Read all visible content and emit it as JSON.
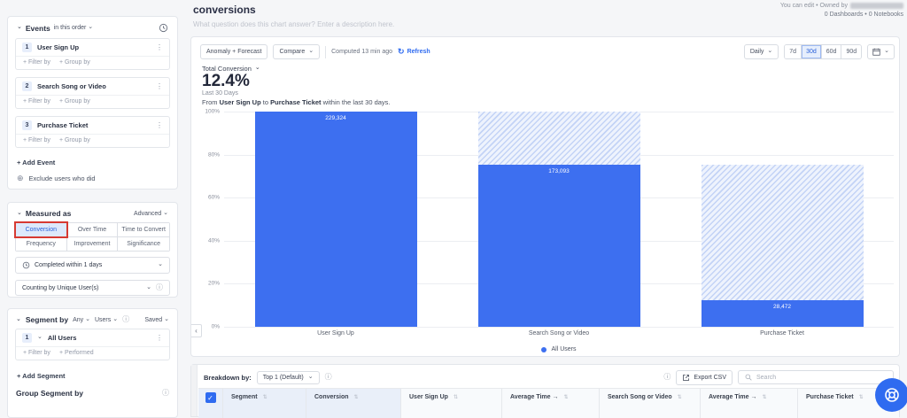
{
  "page": {
    "title": "conversions",
    "description_placeholder": "What question does this chart answer? Enter a description here.",
    "permission_text": "You can edit • Owned by",
    "counts_text": "0 Dashboards • 0 Notebooks"
  },
  "sidebar": {
    "events": {
      "title": "Events",
      "order_label": "in this order",
      "items": [
        {
          "index": "1",
          "name": "User Sign Up"
        },
        {
          "index": "2",
          "name": "Search Song or Video"
        },
        {
          "index": "3",
          "name": "Purchase Ticket"
        }
      ],
      "filter_by": "+ Filter by",
      "group_by": "+ Group by",
      "add_event": "+ Add Event",
      "exclude": "Exclude users who did"
    },
    "measured_as": {
      "title": "Measured as",
      "advanced": "Advanced",
      "options": [
        "Conversion",
        "Over Time",
        "Time to Convert",
        "Frequency",
        "Improvement",
        "Significance"
      ],
      "selected": "Conversion",
      "completed_within": "Completed within 1 days",
      "counting_by": "Counting by Unique User(s)"
    },
    "segment_by": {
      "title": "Segment by",
      "any_label": "Any",
      "users_label": "Users",
      "saved_label": "Saved",
      "item": {
        "index": "1",
        "name": "All Users"
      },
      "filter_by": "+ Filter by",
      "performed": "+ Performed",
      "add_segment": "+ Add Segment",
      "group_segment_by": "Group Segment by"
    }
  },
  "toolbar": {
    "anomaly_forecast": "Anomaly + Forecast",
    "compare": "Compare",
    "computed": "Computed 13 min ago",
    "refresh": "Refresh",
    "granularity": "Daily",
    "ranges": [
      "7d",
      "30d",
      "60d",
      "90d"
    ],
    "selected_range": "30d"
  },
  "kpi": {
    "metric_label": "Total Conversion",
    "value": "12.4%",
    "period": "Last 30 Days",
    "desc_prefix": "From",
    "from_event": "User Sign Up",
    "desc_mid": "to",
    "to_event": "Purchase Ticket",
    "desc_suffix": "within the last 30 days."
  },
  "chart_data": {
    "type": "bar",
    "title": "Total Conversion funnel",
    "categories": [
      "User Sign Up",
      "Search Song or Video",
      "Purchase Ticket"
    ],
    "series": [
      {
        "name": "All Users",
        "counts": [
          229324,
          173093,
          28472
        ],
        "percents": [
          100,
          75.5,
          12.4
        ]
      }
    ],
    "value_labels": [
      "229,324",
      "173,093",
      "28,472"
    ],
    "yticks": [
      "0%",
      "20%",
      "40%",
      "60%",
      "80%",
      "100%"
    ],
    "ylim": [
      0,
      100
    ],
    "legend": [
      "All Users"
    ],
    "bar_color": "#3d6ff0",
    "grid": true,
    "legend_position": "bottom-center"
  },
  "breakdown": {
    "label": "Breakdown by:",
    "top_selector": "Top 1 (Default)",
    "export_label": "Export CSV",
    "search_placeholder": "Search",
    "columns": [
      "Segment",
      "Conversion",
      "User Sign Up",
      "Average Time →",
      "Search Song or Video",
      "Average Time →",
      "Purchase Ticket"
    ]
  }
}
